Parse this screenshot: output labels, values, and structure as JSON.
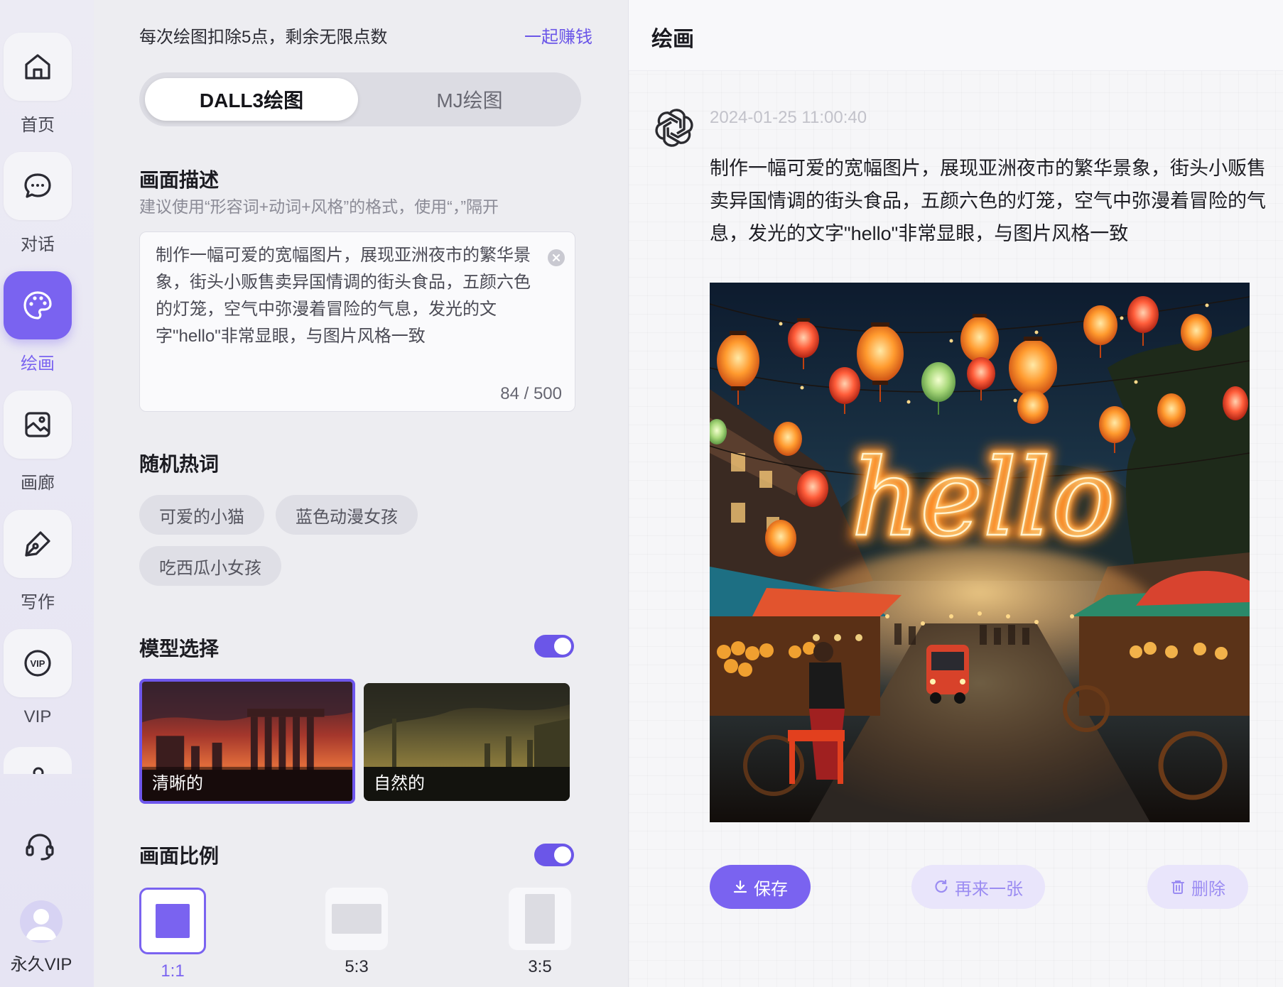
{
  "sidebar": {
    "items": [
      {
        "label": "首页",
        "icon": "home-icon",
        "active": false
      },
      {
        "label": "对话",
        "icon": "chat-icon",
        "active": false
      },
      {
        "label": "绘画",
        "icon": "palette-icon",
        "active": true
      },
      {
        "label": "画廊",
        "icon": "gallery-icon",
        "active": false
      },
      {
        "label": "写作",
        "icon": "pen-icon",
        "active": false
      },
      {
        "label": "VIP",
        "icon": "vip-icon",
        "active": false
      }
    ],
    "user_label": "永久VIP"
  },
  "draw": {
    "points_text": "每次绘图扣除5点，剩余无限点数",
    "earn_link": "一起赚钱",
    "tabs": [
      "DALL3绘图",
      "MJ绘图"
    ],
    "description": {
      "title": "画面描述",
      "hint": "建议使用“形容词+动词+风格”的格式，使用“，”隔开",
      "value": "制作一幅可爱的宽幅图片，展现亚洲夜市的繁华景象，街头小贩售卖异国情调的街头食品，五颜六色的灯笼，空气中弥漫着冒险的气息，发光的文字\"hello\"非常显眼，与图片风格一致",
      "counter": "84 / 500"
    },
    "hot_words": {
      "title": "随机热词",
      "chips": [
        "可爱的小猫",
        "蓝色动漫女孩",
        "吃西瓜小女孩"
      ]
    },
    "model": {
      "title": "模型选择",
      "enabled": true,
      "options": [
        {
          "label": "清晰的",
          "selected": true
        },
        {
          "label": "自然的",
          "selected": false
        }
      ]
    },
    "ratio": {
      "title": "画面比例",
      "enabled": true,
      "options": [
        {
          "label": "1:1",
          "selected": true
        },
        {
          "label": "5:3",
          "selected": false
        },
        {
          "label": "3:5",
          "selected": false
        }
      ]
    }
  },
  "result": {
    "title": "绘画",
    "timestamp": "2024-01-25 11:00:40",
    "message": "制作一幅可爱的宽幅图片，展现亚洲夜市的繁华景象，街头小贩售卖异国情调的街头食品，五颜六色的灯笼，空气中弥漫着冒险的气息，发光的文字\"hello\"非常显眼，与图片风格一致",
    "image_text": "hello",
    "actions": {
      "save": "保存",
      "regenerate": "再来一张",
      "delete": "删除"
    }
  },
  "colors": {
    "accent": "#7a63f0",
    "accent_soft": "#e9e5fb"
  }
}
